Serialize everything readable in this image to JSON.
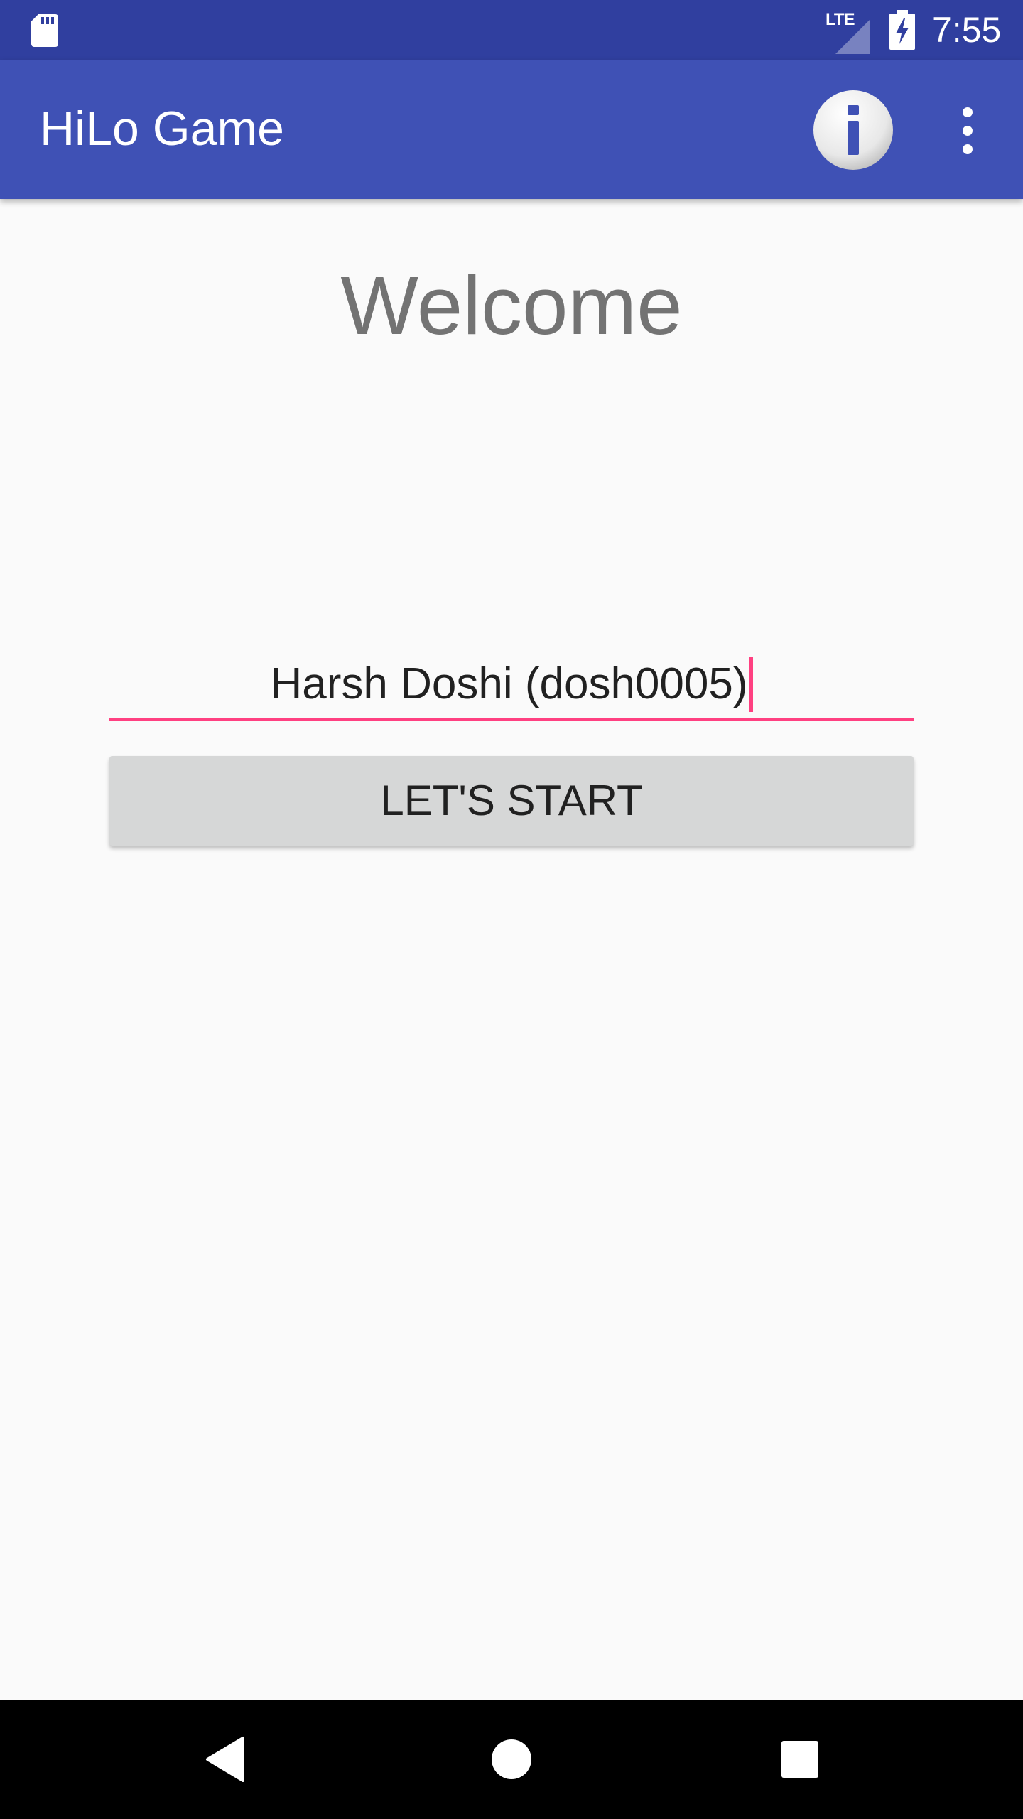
{
  "status_bar": {
    "network_label": "LTE",
    "time": "7:55",
    "icons": [
      "sd-card-icon",
      "signal-icon",
      "battery-charging-icon"
    ]
  },
  "app_bar": {
    "title": "HiLo Game",
    "icons": [
      "info-icon",
      "overflow-menu-icon"
    ]
  },
  "main": {
    "welcome_text": "Welcome",
    "name_input_value": "Harsh Doshi (dosh0005)",
    "start_button_label": "LET'S START"
  },
  "nav_bar": {
    "icons": [
      "back-icon",
      "home-icon",
      "recents-icon"
    ]
  },
  "colors": {
    "status_bar": "#303f9f",
    "app_bar": "#3f51b5",
    "accent": "#ff4081",
    "background": "#fafafa",
    "button": "#d6d7d7",
    "welcome_text": "#737373"
  }
}
